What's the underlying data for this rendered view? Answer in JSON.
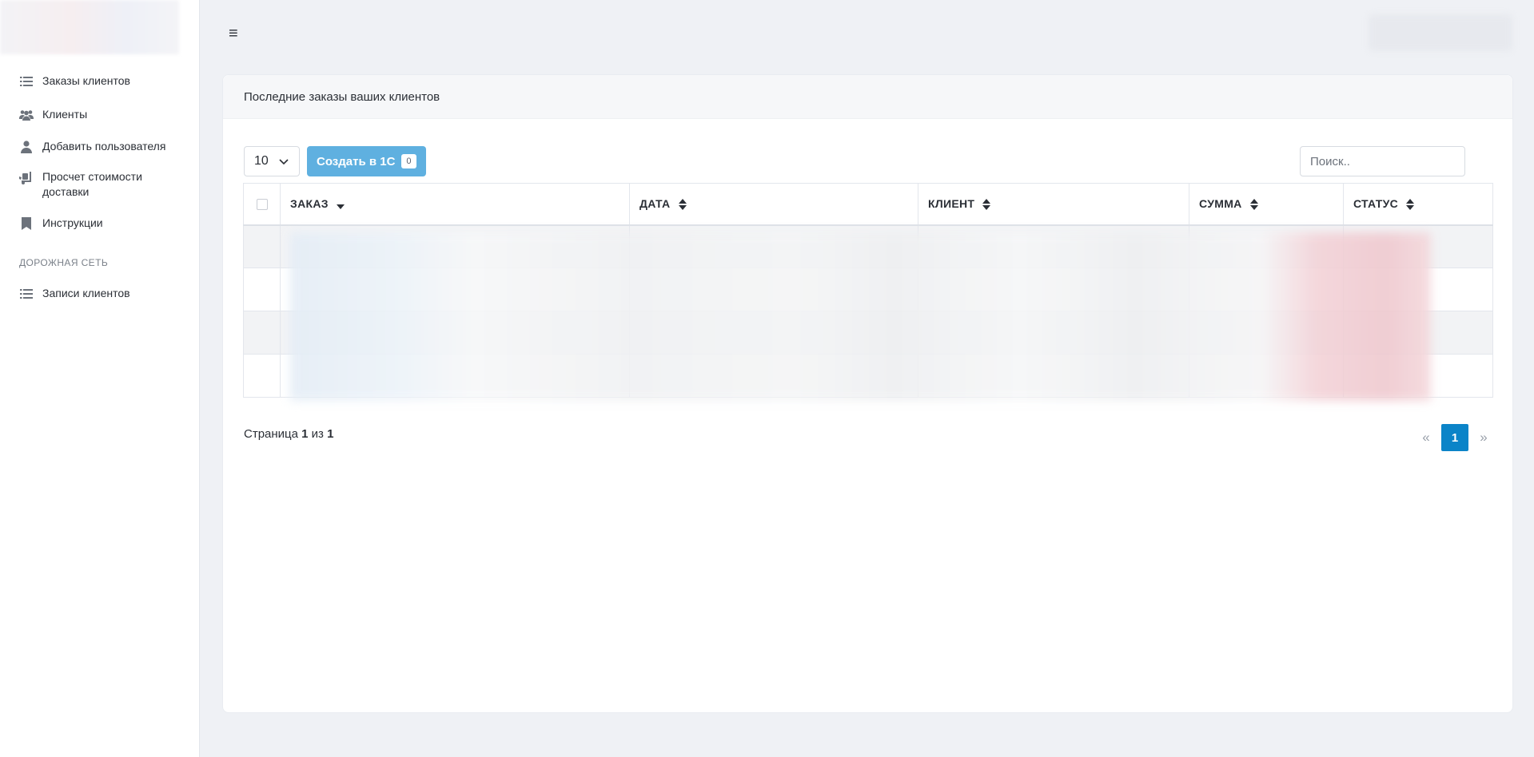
{
  "sidebar": {
    "items": [
      {
        "label": "Заказы клиентов",
        "icon": "list-icon"
      },
      {
        "label": "Клиенты",
        "icon": "users-icon"
      },
      {
        "label": "Добавить пользователя",
        "icon": "user-icon"
      },
      {
        "label": "Просчет стоимости доставки",
        "icon": "dolly-icon"
      },
      {
        "label": "Инструкции",
        "icon": "bookmark-icon"
      }
    ],
    "section_title": "ДОРОЖНАЯ СЕТЬ",
    "section_items": [
      {
        "label": "Записи клиентов",
        "icon": "list-icon"
      }
    ]
  },
  "header": {
    "menu_icon": "≡"
  },
  "card": {
    "title": "Последние заказы ваших клиентов",
    "page_length": "10",
    "create_button": {
      "label": "Создать в 1С",
      "count": "0"
    },
    "search_placeholder": "Поиск..",
    "columns": [
      "ЗАКАЗ",
      "ДАТА",
      "КЛИЕНТ",
      "СУММА",
      "СТАТУС"
    ],
    "sorted_column": "ЗАКАЗ",
    "sort_direction": "desc",
    "row_count": 4
  },
  "footer": {
    "page_prefix": "Страница",
    "current_page": "1",
    "of_word": "из",
    "total_pages": "1",
    "prev": "«",
    "next": "»"
  },
  "colors": {
    "accent": "#0b84c8",
    "button": "#5fb0e0",
    "background": "#eff1f5"
  }
}
